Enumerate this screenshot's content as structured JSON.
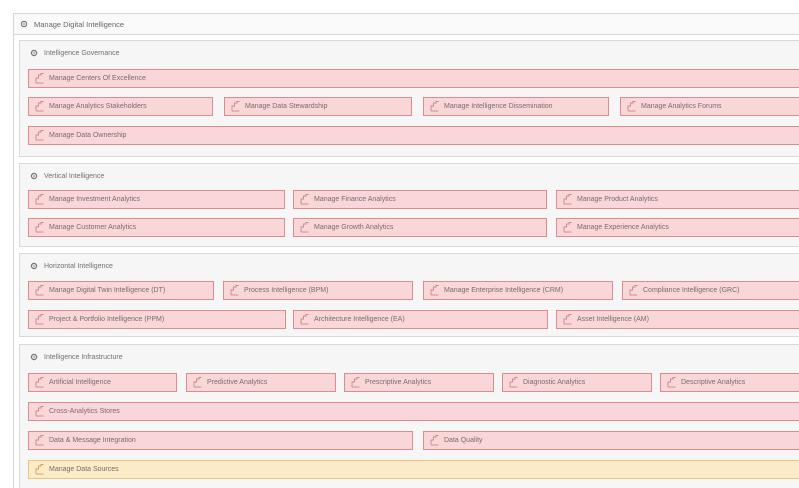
{
  "root": {
    "title": "Manage Digital Intelligence",
    "icon": "gear-icon"
  },
  "sections": [
    {
      "title": "Intelligence Governance",
      "items": [
        "Manage Centers Of Excellence",
        "Manage Analytics Stakeholders",
        "Manage Data Stewardship",
        "Manage Intelligence Dissemination",
        "Manage Analytics Forums",
        "Manage Data Ownership"
      ]
    },
    {
      "title": "Vertical Intelligence",
      "items": [
        "Manage Investment Analytics",
        "Manage Finance Analytics",
        "Manage Product Analytics",
        "Manage Customer Analytics",
        "Manage Growth Analytics",
        "Manage Experience Analytics"
      ]
    },
    {
      "title": "Horizontal Intelligence",
      "items": [
        "Manage Digital Twin Intelligence (DT)",
        "Process Intelligence (BPM)",
        "Manage Enterprise Intelligence (CRM)",
        "Compliance Intelligence (GRC)",
        "Project & Portfolio Intelligence (PPM)",
        "Architecture Intelligence (EA)",
        "Asset Intelligence (AM)"
      ]
    },
    {
      "title": "Intelligence Infrastructure",
      "items": [
        "Artificial Intelligence",
        "Predictive Analytics",
        "Prescriptive Analytics",
        "Diagnostic Analytics",
        "Descriptive Analytics",
        "Cross-Analytics Stores",
        "Data & Message Integration",
        "Data Quality",
        "Manage Data Sources"
      ]
    }
  ],
  "colors": {
    "capability_fill": "#f9d7d8",
    "capability_border": "#dc8c8c",
    "warning_fill": "#fbebc7",
    "warning_border": "#e2c584",
    "section_bg": "#f6f6f6"
  },
  "icons": {
    "section": "gear-icon",
    "capability": "capability-icon"
  }
}
